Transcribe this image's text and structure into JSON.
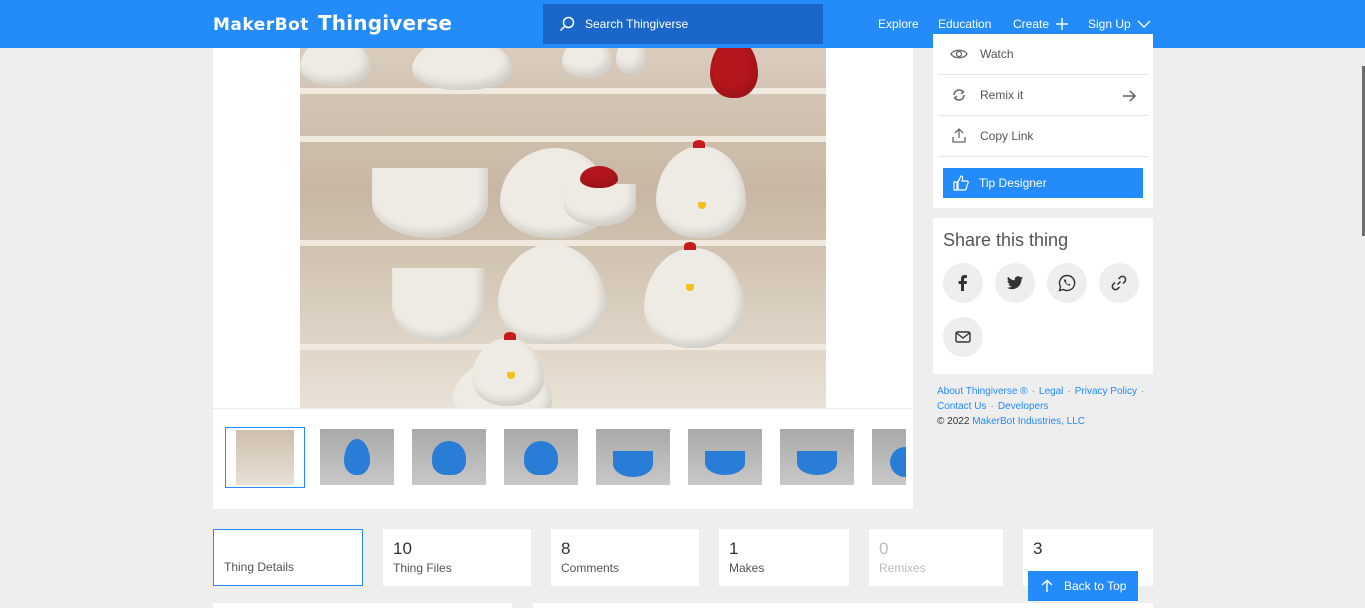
{
  "header": {
    "logo_maker": "MakerBot",
    "logo_thing": "Thingiverse",
    "search_placeholder": "Search Thingiverse",
    "nav": {
      "explore": "Explore",
      "education": "Education",
      "create": "Create",
      "signup": "Sign Up"
    }
  },
  "actions": {
    "watch": "Watch",
    "remix": "Remix it",
    "copy_link": "Copy Link",
    "tip": "Tip Designer"
  },
  "share": {
    "title": "Share this thing"
  },
  "footer": {
    "about": "About Thingiverse ®",
    "legal": "Legal",
    "privacy": "Privacy Policy",
    "contact": "Contact Us",
    "developers": "Developers",
    "copyright": "© 2022",
    "company": "MakerBot Industries, LLC"
  },
  "tabs": [
    {
      "num": "",
      "label": "Thing Details"
    },
    {
      "num": "10",
      "label": "Thing Files"
    },
    {
      "num": "8",
      "label": "Comments"
    },
    {
      "num": "1",
      "label": "Makes"
    },
    {
      "num": "0",
      "label": "Remixes"
    },
    {
      "num": "3",
      "label": ""
    }
  ],
  "back_to_top": "Back to Top",
  "colors": {
    "brand_blue": "#248bfb",
    "search_bg": "#1a66c9",
    "page_bg": "#eeeeee"
  }
}
